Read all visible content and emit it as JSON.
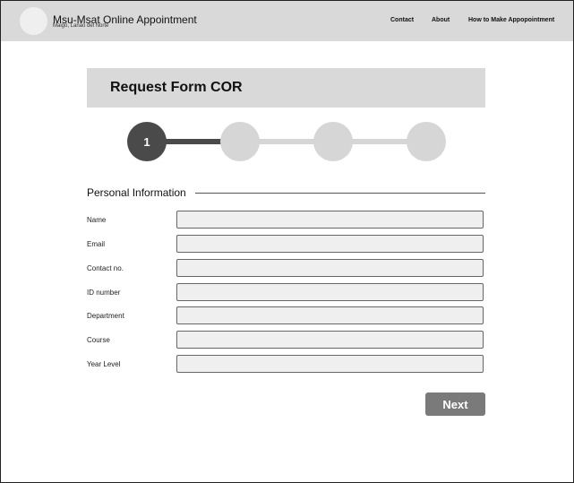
{
  "header": {
    "title": "Msu-Msat Online Appointment",
    "subtitle": "Maigo, Lanao del Norte",
    "nav": [
      "Contact",
      "About",
      "How to Make Appopointment"
    ]
  },
  "form": {
    "title": "Request Form COR",
    "steps": [
      {
        "label": "1",
        "active": true
      },
      {
        "label": "",
        "active": false
      },
      {
        "label": "",
        "active": false
      },
      {
        "label": "",
        "active": false
      }
    ],
    "section_title": "Personal Information",
    "fields": [
      {
        "label": "Name",
        "value": ""
      },
      {
        "label": "Email",
        "value": ""
      },
      {
        "label": "Contact no.",
        "value": ""
      },
      {
        "label": "ID number",
        "value": ""
      },
      {
        "label": "Department",
        "value": ""
      },
      {
        "label": "Course",
        "value": ""
      },
      {
        "label": "Year Level",
        "value": ""
      }
    ],
    "next_label": "Next"
  },
  "colors": {
    "topbar": "#d9d9d9",
    "step_active": "#4a4a4a",
    "step_inactive": "#d6d6d6",
    "button": "#7a7a7a"
  }
}
